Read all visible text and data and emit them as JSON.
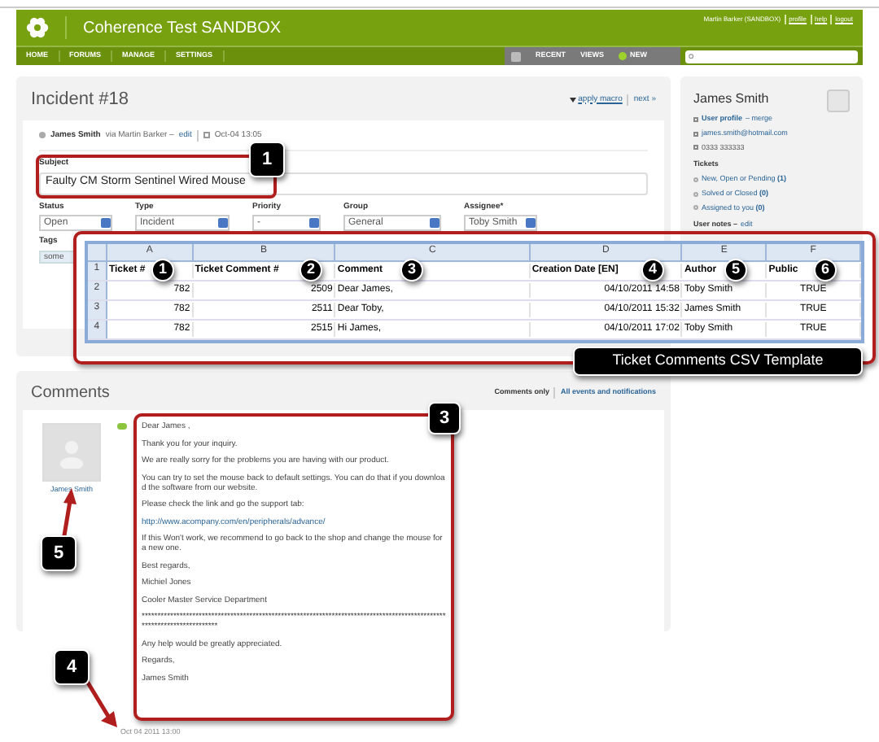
{
  "header": {
    "title": "Coherence Test SANDBOX",
    "user": "Martin Barker (SANDBOX)",
    "links": [
      "profile",
      "help",
      "logout"
    ]
  },
  "nav": {
    "items": [
      "HOME",
      "FORUMS",
      "MANAGE",
      "SETTINGS"
    ],
    "right_items": [
      "RECENT",
      "VIEWS",
      "NEW"
    ]
  },
  "incident": {
    "title": "Incident #18",
    "apply_macro": "apply macro",
    "next": "next »",
    "author": "James Smith",
    "via": "via Martin Barker –",
    "edit": "edit",
    "date": "Oct-04 13:05",
    "subject_label": "Subject",
    "subject": "Faulty CM Storm Sentinel Wired Mouse",
    "subject_callout": "1",
    "fields": [
      {
        "label": "Status",
        "value": "Open"
      },
      {
        "label": "Type",
        "value": "Incident"
      },
      {
        "label": "Priority",
        "value": "-"
      },
      {
        "label": "Group",
        "value": "General"
      },
      {
        "label": "Assignee*",
        "value": "Toby Smith"
      }
    ],
    "tags_label": "Tags",
    "tag": "some"
  },
  "sidebar": {
    "name": "James Smith",
    "profile": "User profile",
    "merge": "– merge",
    "email": "james.smith@hotmail.com",
    "phone": "0333 333333",
    "tickets_label": "Tickets",
    "tickets": [
      {
        "label": "New, Open or Pending",
        "count": "(1)"
      },
      {
        "label": "Solved or Closed",
        "count": "(0)"
      },
      {
        "label": "Assigned to you",
        "count": "(0)"
      }
    ],
    "notes": "User notes –",
    "notes_edit": "edit"
  },
  "spreadsheet": {
    "columns": [
      {
        "letter": "A",
        "heading": "Ticket #",
        "callout": "1"
      },
      {
        "letter": "B",
        "heading": "Ticket Comment #",
        "callout": "2"
      },
      {
        "letter": "C",
        "heading": "Comment",
        "callout": "3"
      },
      {
        "letter": "D",
        "heading": "Creation Date [EN]",
        "callout": "4"
      },
      {
        "letter": "E",
        "heading": "Author",
        "callout": "5"
      },
      {
        "letter": "F",
        "heading": "Public",
        "callout": "6"
      }
    ],
    "row_numbers": [
      "1",
      "2",
      "3",
      "4"
    ],
    "rows": [
      [
        "782",
        "2509",
        "Dear James,",
        "04/10/2011 14:58",
        "Toby Smith",
        "TRUE"
      ],
      [
        "782",
        "2511",
        "Dear Toby,",
        "04/10/2011 15:32",
        "James Smith",
        "TRUE"
      ],
      [
        "782",
        "2515",
        "Hi James,",
        "04/10/2011 17:02",
        "Toby Smith",
        "TRUE"
      ]
    ],
    "caption": "Ticket Comments CSV Template"
  },
  "comments": {
    "title": "Comments",
    "filters": [
      {
        "label": "Comments only",
        "selected": true
      },
      {
        "label": "All events and notifications",
        "selected": false
      }
    ],
    "author": "James Smith",
    "author_callout": "5",
    "body_callout": "3",
    "date_callout": "4",
    "body": [
      {
        "kind": "text",
        "text": "Dear James ,"
      },
      {
        "kind": "text",
        "text": "Thank you for your inquiry."
      },
      {
        "kind": "text",
        "text": "We are really sorry for the problems you are having with our product."
      },
      {
        "kind": "text",
        "text": "You can try to set the mouse back to default settings. You can do that if you download the software from our website."
      },
      {
        "kind": "text",
        "text": "Please check the link and go the support tab:"
      },
      {
        "kind": "link",
        "text": "http://www.acompany.com/en/peripherals/advance/"
      },
      {
        "kind": "text",
        "text": "If this Won't work, we recommend to go back to the shop and change the mouse for a new one."
      },
      {
        "kind": "text",
        "text": "Best regards,"
      },
      {
        "kind": "text",
        "text": "Michiel Jones"
      },
      {
        "kind": "text",
        "text": "Cooler Master Service Department"
      },
      {
        "kind": "text",
        "text": "************************************************************************************************************************"
      },
      {
        "kind": "text",
        "text": "Any help would be greatly appreciated."
      },
      {
        "kind": "text",
        "text": "Regards,"
      },
      {
        "kind": "text",
        "text": "James Smith"
      }
    ],
    "date": "Oct 04 2011 13:00"
  }
}
